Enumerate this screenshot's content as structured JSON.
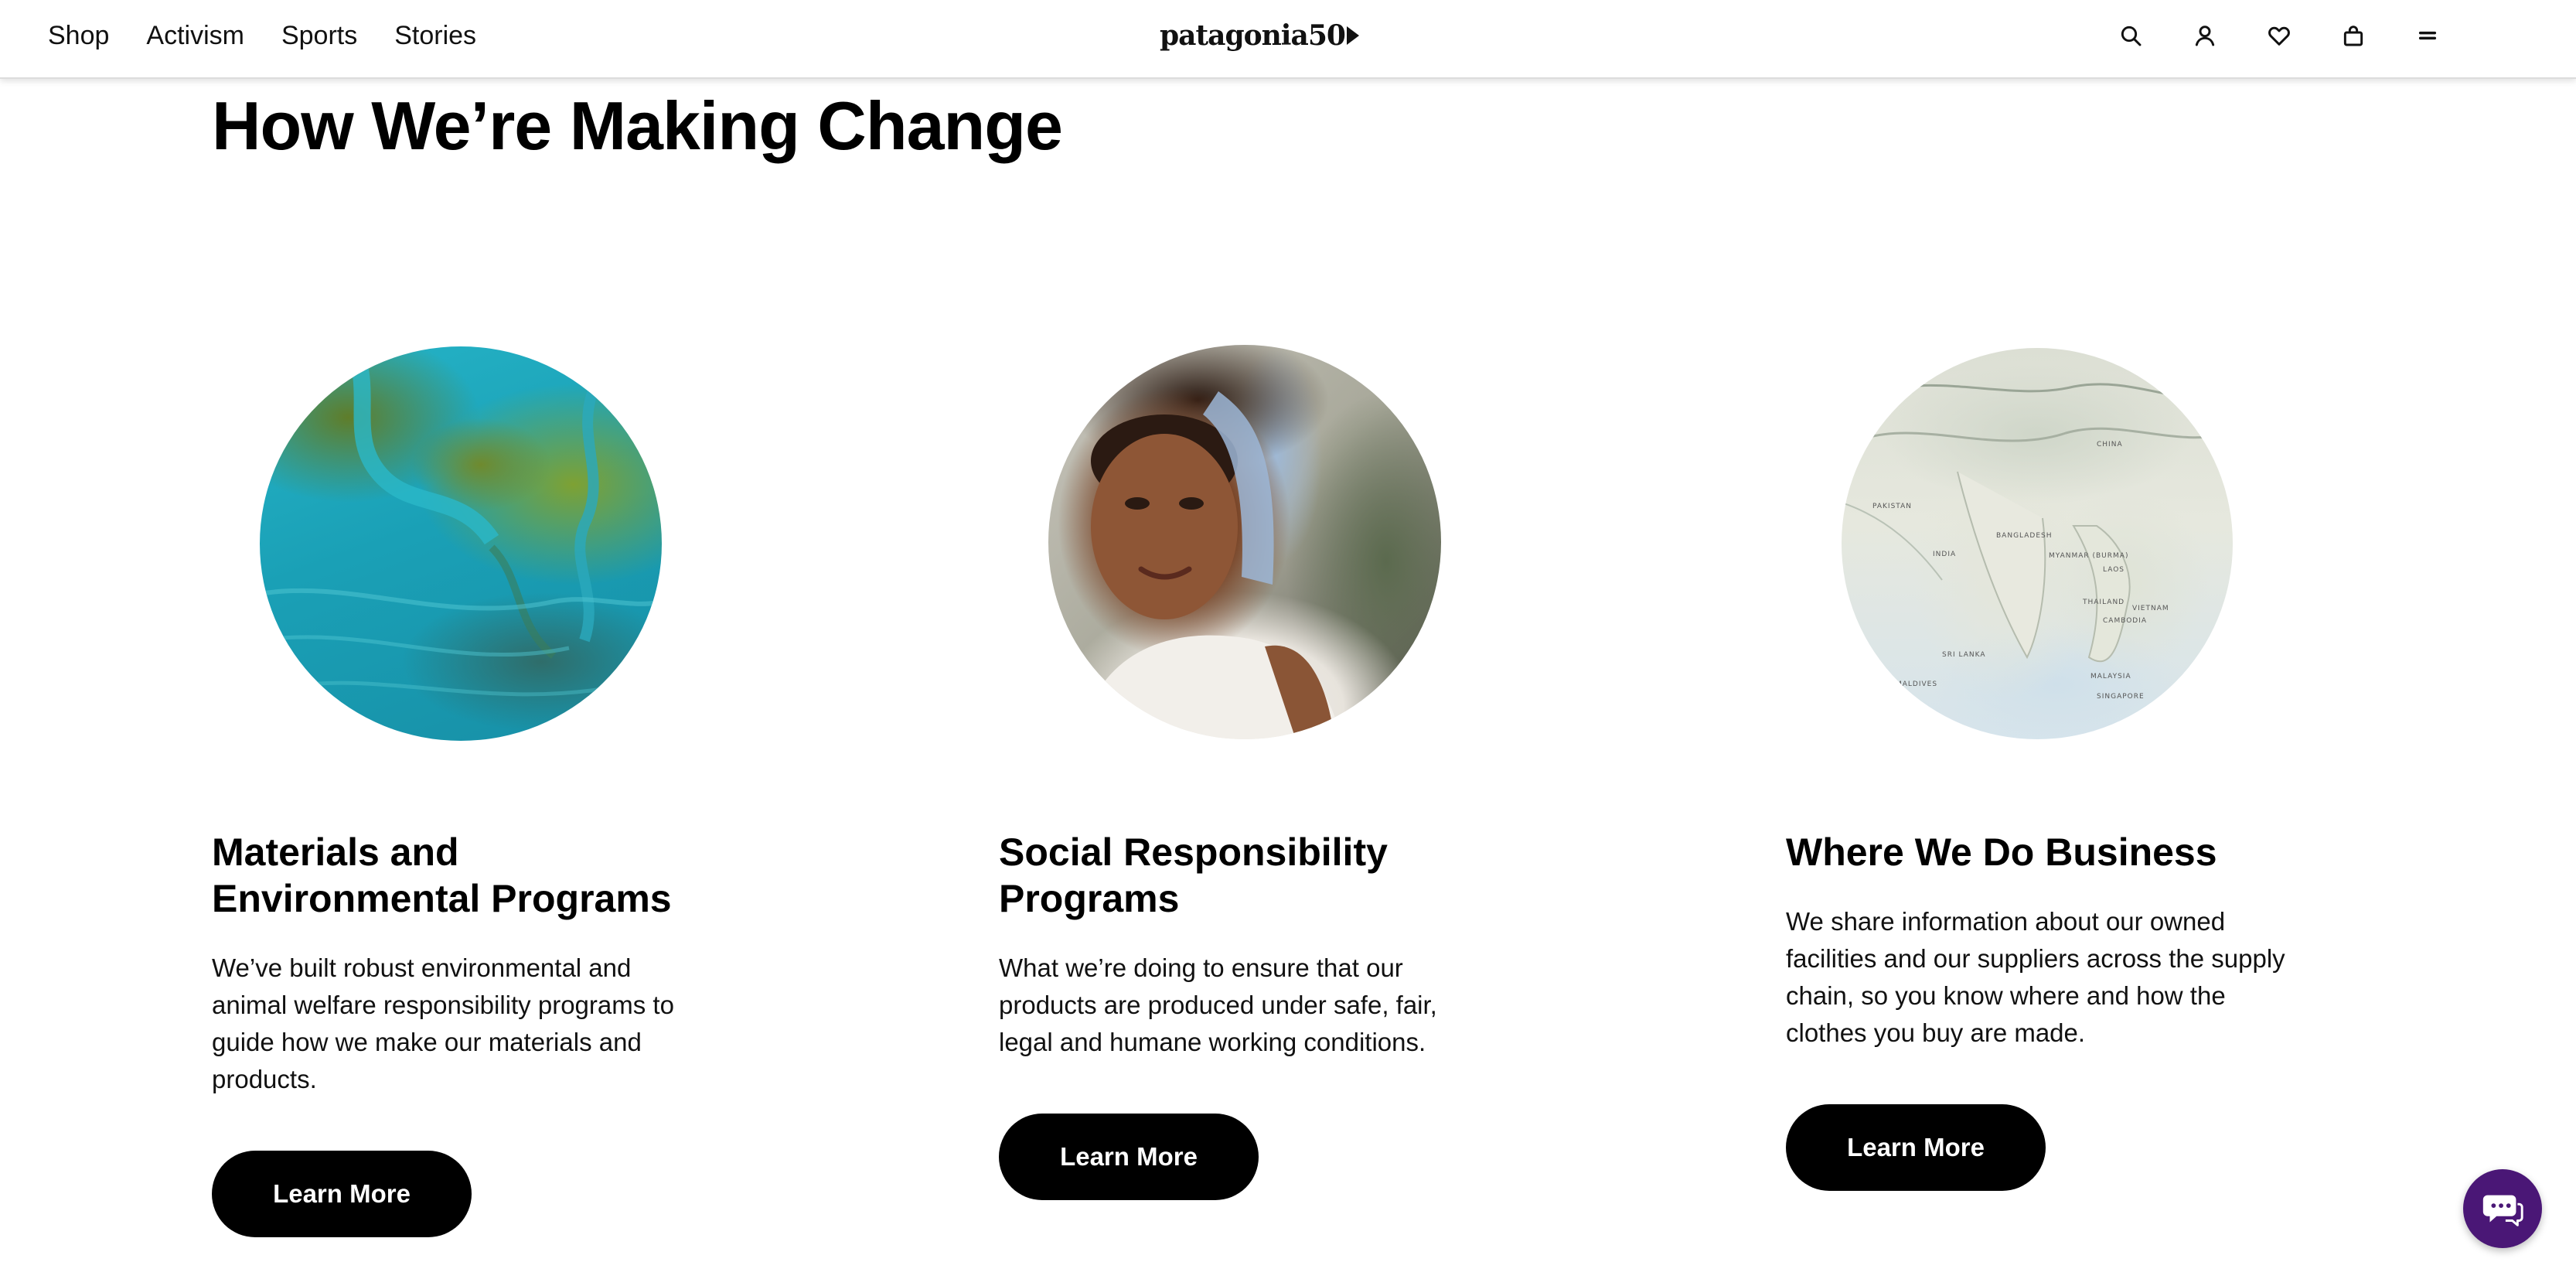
{
  "header": {
    "nav": [
      {
        "label": "Shop"
      },
      {
        "label": "Activism"
      },
      {
        "label": "Sports"
      },
      {
        "label": "Stories"
      }
    ],
    "logo_text": "patagonia50",
    "icons": [
      "search-icon",
      "account-icon",
      "wishlist-icon",
      "cart-icon",
      "menu-icon"
    ]
  },
  "main": {
    "title": "How We’re Making Change",
    "cards": [
      {
        "title_line1": "Materials and",
        "title_line2": "Environmental Programs",
        "desc": "We’ve built robust environmental and animal welfare responsibility programs to guide how we make our materials and products.",
        "button": "Learn More"
      },
      {
        "title_line1": "Social Responsibility",
        "title_line2": "Programs",
        "desc": "What we’re doing to ensure that our products are produced under safe, fair, legal and humane working conditions.",
        "button": "Learn More"
      },
      {
        "title_line1": "Where We Do Business",
        "title_line2": "",
        "desc": "We share information about our owned facilities and our suppliers across the supply chain, so you know where and how the clothes you buy are made.",
        "button": "Learn More"
      }
    ],
    "map_labels": [
      "PAKISTAN",
      "BANGLADESH",
      "INDIA",
      "MYANMAR (BURMA)",
      "LAOS",
      "THAILAND",
      "VIETNAM",
      "CAMBODIA",
      "SRI LANKA",
      "MALAYSIA",
      "SINGAPORE",
      "MALDIVES",
      "CHINA"
    ]
  },
  "colors": {
    "button_bg": "#000000",
    "chat_bg": "#4a1776"
  }
}
